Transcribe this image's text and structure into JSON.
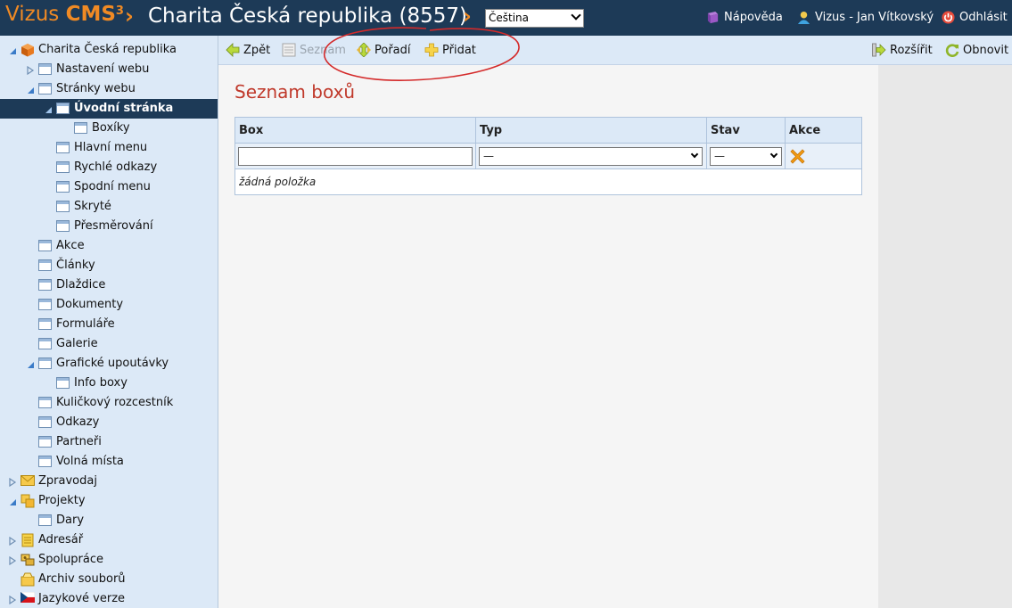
{
  "header": {
    "brand": "Vizus",
    "brand_cms": "CMS",
    "brand_sup": "3",
    "site_title": "Charita Česká republika (8557)",
    "language": "Čeština",
    "help": "Nápověda",
    "user": "Vizus - Jan Vítkovský",
    "logout": "Odhlásit"
  },
  "sidebar": {
    "items": [
      {
        "label": "Charita Česká republika",
        "icon": "cube-icon"
      },
      {
        "label": "Nastavení webu",
        "icon": "page-icon"
      },
      {
        "label": "Stránky webu",
        "icon": "page-icon"
      },
      {
        "label": "Úvodní stránka",
        "icon": "page-icon"
      },
      {
        "label": "Boxíky",
        "icon": "page-icon"
      },
      {
        "label": "Hlavní menu",
        "icon": "page-icon"
      },
      {
        "label": "Rychlé odkazy",
        "icon": "page-icon"
      },
      {
        "label": "Spodní menu",
        "icon": "page-icon"
      },
      {
        "label": "Skryté",
        "icon": "page-icon"
      },
      {
        "label": "Přesměrování",
        "icon": "page-icon"
      },
      {
        "label": "Akce",
        "icon": "page-icon"
      },
      {
        "label": "Články",
        "icon": "page-icon"
      },
      {
        "label": "Dlaždice",
        "icon": "page-icon"
      },
      {
        "label": "Dokumenty",
        "icon": "page-icon"
      },
      {
        "label": "Formuláře",
        "icon": "page-icon"
      },
      {
        "label": "Galerie",
        "icon": "page-icon"
      },
      {
        "label": "Grafické upoutávky",
        "icon": "page-icon"
      },
      {
        "label": "Info boxy",
        "icon": "page-icon"
      },
      {
        "label": "Kuličkový rozcestník",
        "icon": "page-icon"
      },
      {
        "label": "Odkazy",
        "icon": "page-icon"
      },
      {
        "label": "Partneři",
        "icon": "page-icon"
      },
      {
        "label": "Volná místa",
        "icon": "page-icon"
      },
      {
        "label": "Zpravodaj",
        "icon": "envelope-icon"
      },
      {
        "label": "Projekty",
        "icon": "folders-icon"
      },
      {
        "label": "Dary",
        "icon": "page-icon"
      },
      {
        "label": "Adresář",
        "icon": "address-book-icon"
      },
      {
        "label": "Spolupráce",
        "icon": "handshake-icon"
      },
      {
        "label": "Archiv souborů",
        "icon": "archive-icon"
      },
      {
        "label": "Jazykové verze",
        "icon": "czech-flag-icon"
      }
    ]
  },
  "toolbar": {
    "back": "Zpět",
    "list": "Seznam",
    "order": "Pořadí",
    "add": "Přidat",
    "expand": "Rozšířit",
    "refresh": "Obnovit"
  },
  "main": {
    "heading": "Seznam boxů",
    "columns": [
      "Box",
      "Typ",
      "Stav",
      "Akce"
    ],
    "filter_type_value": "—",
    "filter_state_value": "—",
    "empty_text": "žádná položka"
  },
  "colors": {
    "header_bg": "#1d3a57",
    "accent_orange": "#f08a24",
    "heading_red": "#c0392b",
    "sidebar_bg": "#dce9f7",
    "annotation_red": "#d42a2a"
  }
}
